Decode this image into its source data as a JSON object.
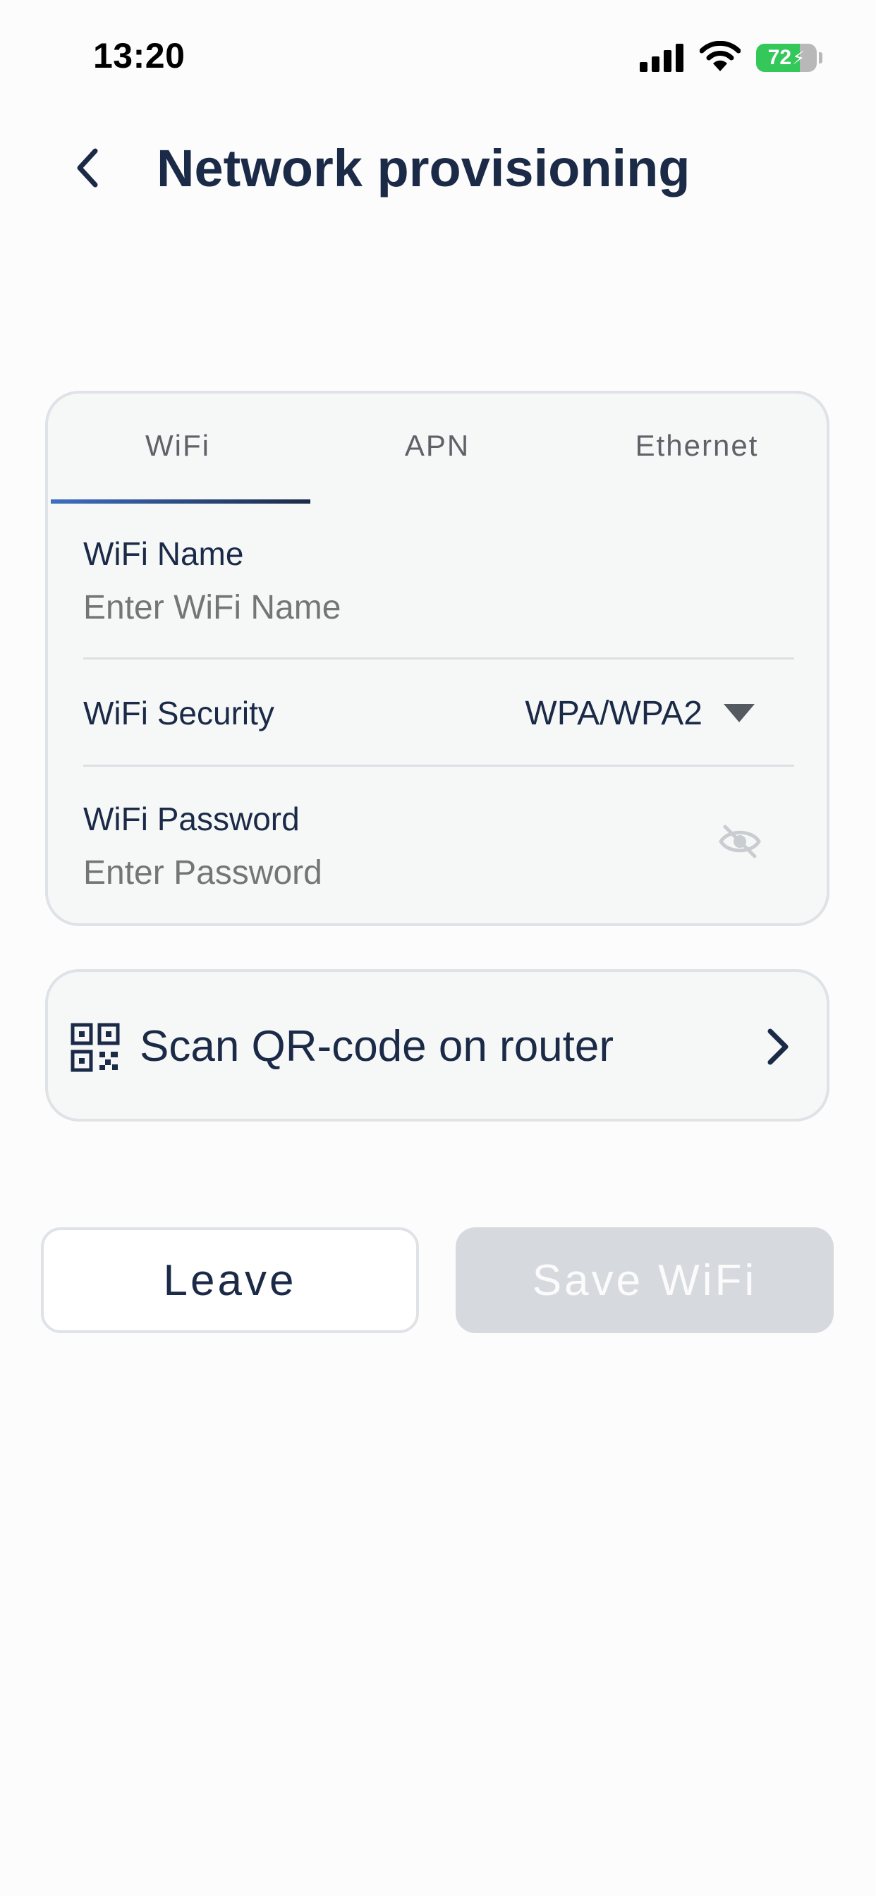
{
  "status_bar": {
    "time": "13:20",
    "battery": "72"
  },
  "header": {
    "title": "Network provisioning"
  },
  "tabs": [
    {
      "label": "WiFi",
      "active": true
    },
    {
      "label": "APN",
      "active": false
    },
    {
      "label": "Ethernet",
      "active": false
    }
  ],
  "wifi_form": {
    "name_label": "WiFi Name",
    "name_placeholder": "Enter WiFi Name",
    "security_label": "WiFi Security",
    "security_value": "WPA/WPA2",
    "password_label": "WiFi Password",
    "password_placeholder": "Enter Password"
  },
  "qr": {
    "label": "Scan QR-code on router"
  },
  "actions": {
    "leave_label": "Leave",
    "save_label": "Save WiFi"
  },
  "icons": [
    "signal-icon",
    "wifi-icon",
    "battery-icon",
    "back-chevron-icon",
    "caret-down-icon",
    "eye-off-icon",
    "qr-code-icon",
    "chevron-right-icon"
  ],
  "colors": {
    "primary": "#1b2a47",
    "accent": "#3e6fc2",
    "battery_green": "#34c759",
    "disabled": "#d6d9de"
  }
}
